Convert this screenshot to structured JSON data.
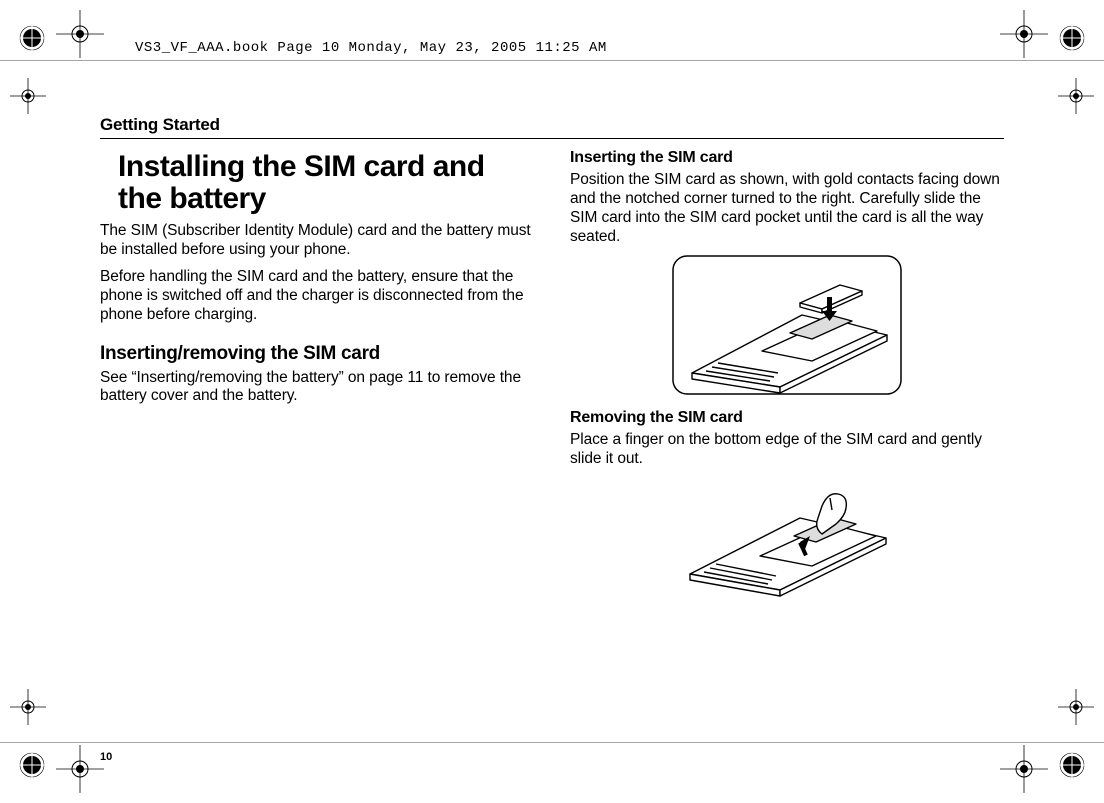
{
  "meta": {
    "header_line": "VS3_VF_AAA.book  Page 10  Monday, May 23, 2005  11:25 AM",
    "page_number": "10"
  },
  "running_head": "Getting Started",
  "left": {
    "title": "Installing the SIM card and the battery",
    "p1": "The SIM (Subscriber Identity Module) card and the battery must be installed before using your phone.",
    "p2": "Before handling the SIM card and the battery, ensure that the phone is switched off and the charger is disconnected from the phone before charging.",
    "h2": "Inserting/removing the SIM card",
    "p3": "See “Inserting/removing the battery” on page 11 to remove the battery cover and the battery."
  },
  "right": {
    "h3a": "Inserting the SIM card",
    "p1": "Position the SIM card as shown, with gold contacts facing down and the notched corner turned to the right. Carefully slide the SIM card into the SIM card pocket until the card is all the way seated.",
    "h3b": "Removing the SIM card",
    "p2": "Place a finger on the bottom edge of the SIM card and gently slide it out."
  }
}
